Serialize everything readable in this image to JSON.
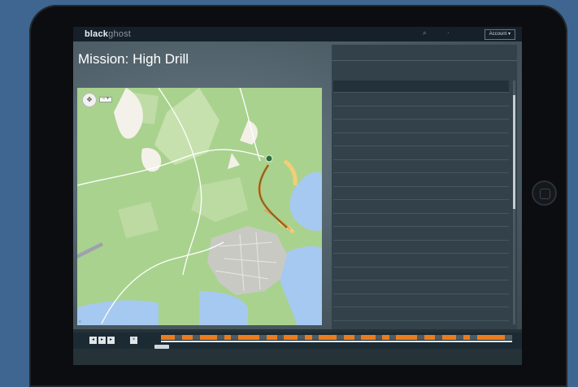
{
  "app": {
    "logo_a": "black",
    "logo_b": "ghost",
    "account_label": "Account"
  },
  "mission": {
    "title": "Mission: High Drill",
    "subtitle_1": "",
    "subtitle_2": ""
  },
  "panel": {
    "tabs": [
      "",
      "",
      ""
    ],
    "caption": "",
    "columns": [
      "",
      "",
      "",
      ""
    ],
    "rows": [
      [
        "",
        "",
        "",
        "",
        ""
      ],
      [
        "",
        "",
        "",
        "",
        ""
      ],
      [
        "",
        "",
        "",
        "",
        ""
      ],
      [
        "",
        "",
        "",
        "",
        ""
      ],
      [
        "",
        "",
        "",
        "",
        ""
      ],
      [
        "",
        "",
        "",
        "",
        ""
      ],
      [
        "",
        "",
        "",
        "",
        ""
      ],
      [
        "",
        "",
        "",
        "",
        ""
      ],
      [
        "",
        "",
        "",
        "",
        ""
      ],
      [
        "",
        "",
        "",
        "",
        ""
      ],
      [
        "",
        "",
        "",
        "",
        ""
      ],
      [
        "",
        "",
        "",
        "",
        ""
      ],
      [
        "",
        "",
        "",
        "",
        ""
      ],
      [
        "",
        "",
        "",
        "",
        ""
      ],
      [
        "",
        "",
        "",
        "",
        ""
      ],
      [
        "",
        "",
        "",
        "",
        ""
      ],
      [
        "",
        "",
        "",
        "",
        ""
      ],
      [
        "",
        "",
        "",
        "",
        ""
      ],
      [
        "",
        "",
        "",
        "",
        ""
      ]
    ]
  },
  "timeline": {
    "footer_right": ""
  },
  "icons": {
    "map_nav": "compass-icon",
    "play": "play-icon"
  },
  "colors": {
    "accent_orange": "#eb7d1e",
    "map_green": "#a9d28e",
    "water_blue": "#a5c9f0"
  }
}
